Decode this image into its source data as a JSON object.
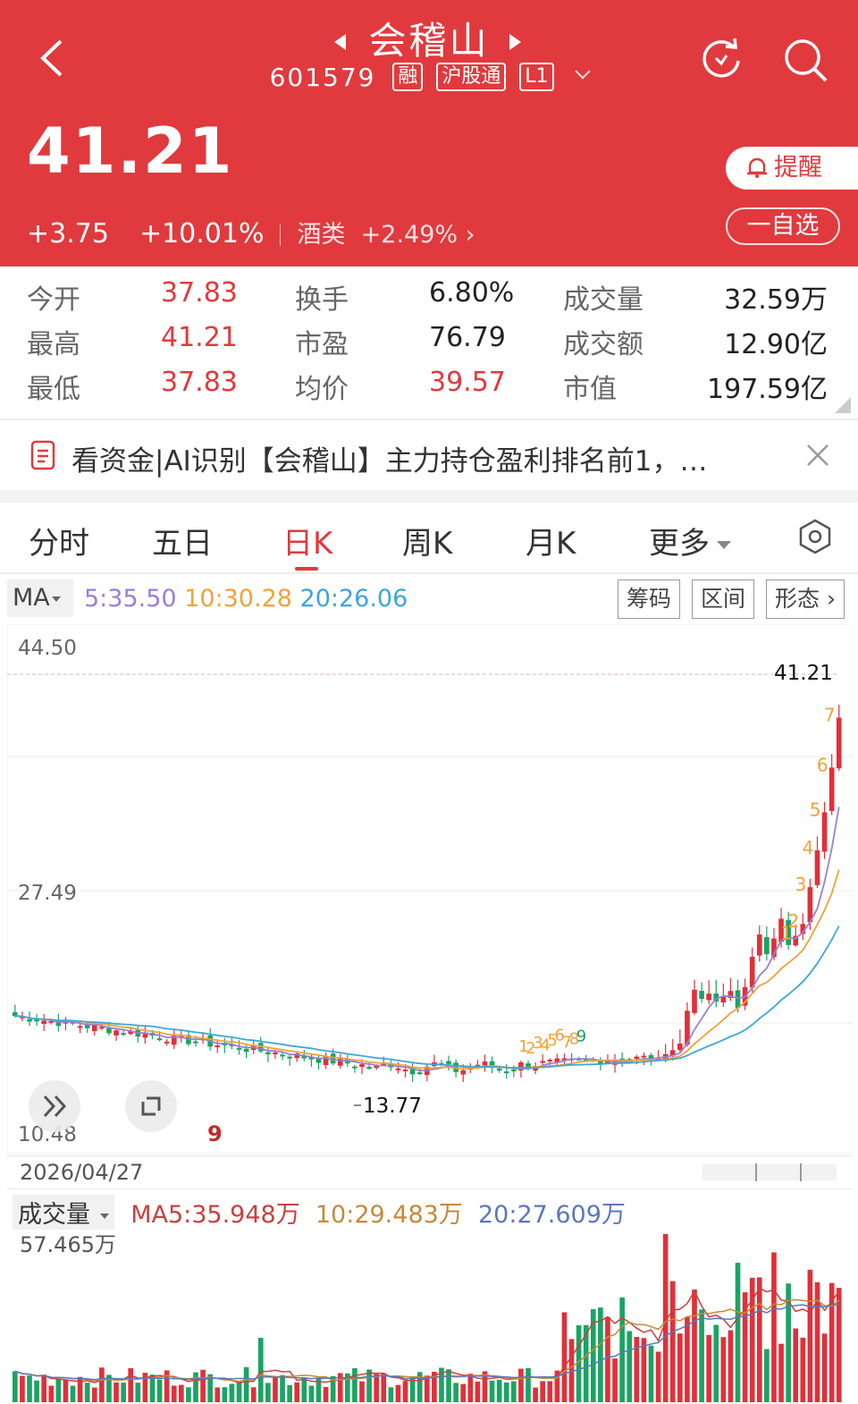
{
  "header": {
    "title": "会稽山",
    "code": "601579",
    "tags": [
      "融",
      "沪股通",
      "L1"
    ],
    "price": "41.21",
    "change": "+3.75",
    "change_pct": "+10.01%",
    "industry": "酒类",
    "industry_pct": "+2.49%",
    "remind_label": "提醒",
    "watch_label": "一自选"
  },
  "stats": [
    {
      "label": "今开",
      "value": "37.83",
      "color": "#e03a3e"
    },
    {
      "label": "换手",
      "value": "6.80%",
      "color": "#222222"
    },
    {
      "label": "成交量",
      "value": "32.59万",
      "color": "#222222"
    },
    {
      "label": "最高",
      "value": "41.21",
      "color": "#e03a3e"
    },
    {
      "label": "市盈",
      "value": "76.79",
      "color": "#222222"
    },
    {
      "label": "成交额",
      "value": "12.90亿",
      "color": "#222222"
    },
    {
      "label": "最低",
      "value": "37.83",
      "color": "#e03a3e"
    },
    {
      "label": "均价",
      "value": "39.57",
      "color": "#e03a3e"
    },
    {
      "label": "市值",
      "value": "197.59亿",
      "color": "#222222"
    }
  ],
  "news": {
    "text": "看资金|AI识别【会稽山】主力持仓盈利排名前1，…"
  },
  "tabs": [
    "分时",
    "五日",
    "日K",
    "周K",
    "月K",
    "更多"
  ],
  "active_tab": "日K",
  "ma": {
    "selector": "MA",
    "ma5": "5:35.50",
    "ma10": "10:30.28",
    "ma20": "20:26.06",
    "colors": {
      "ma5": "#9b7fd3",
      "ma10": "#f0a23a",
      "ma20": "#3ea6d8"
    }
  },
  "chart_buttons": [
    "筹码",
    "区间",
    "形态"
  ],
  "kline": {
    "y_top": "44.50",
    "y_mid": "27.49",
    "y_bottom": "10.48",
    "last_label": "41.21",
    "low_label": "13.77",
    "date": "2026/04/27",
    "marker": "9",
    "seq_late": [
      "1",
      "2",
      "3",
      "4",
      "5",
      "6",
      "7"
    ],
    "seq_early": [
      "1",
      "2",
      "3",
      "4",
      "5",
      "6",
      "7",
      "8",
      "9"
    ]
  },
  "volume": {
    "selector": "成交量",
    "ma5": "MA5:35.948万",
    "ma10": "10:29.483万",
    "ma20": "20:27.609万",
    "max": "57.465万"
  },
  "colors": {
    "up": "#e0303a",
    "down": "#1aa463",
    "brand": "#e03a3e"
  },
  "chart_data": {
    "type": "candlestick",
    "ylim": [
      10.48,
      44.5
    ],
    "last_close": 41.21,
    "low": 13.77,
    "ma_last": {
      "ma5": 35.5,
      "ma10": 30.28,
      "ma20": 26.06
    },
    "recent_closes_approx": [
      15.3,
      15.6,
      15.9,
      16.4,
      18.9,
      20.5,
      19.8,
      20.2,
      19.6,
      20.0,
      20.4,
      19.1,
      20.7,
      23.0,
      24.7,
      23.2,
      24.4,
      25.9,
      23.9,
      24.6,
      25.5,
      28.3,
      31.1,
      34.0,
      37.4,
      41.2
    ]
  }
}
